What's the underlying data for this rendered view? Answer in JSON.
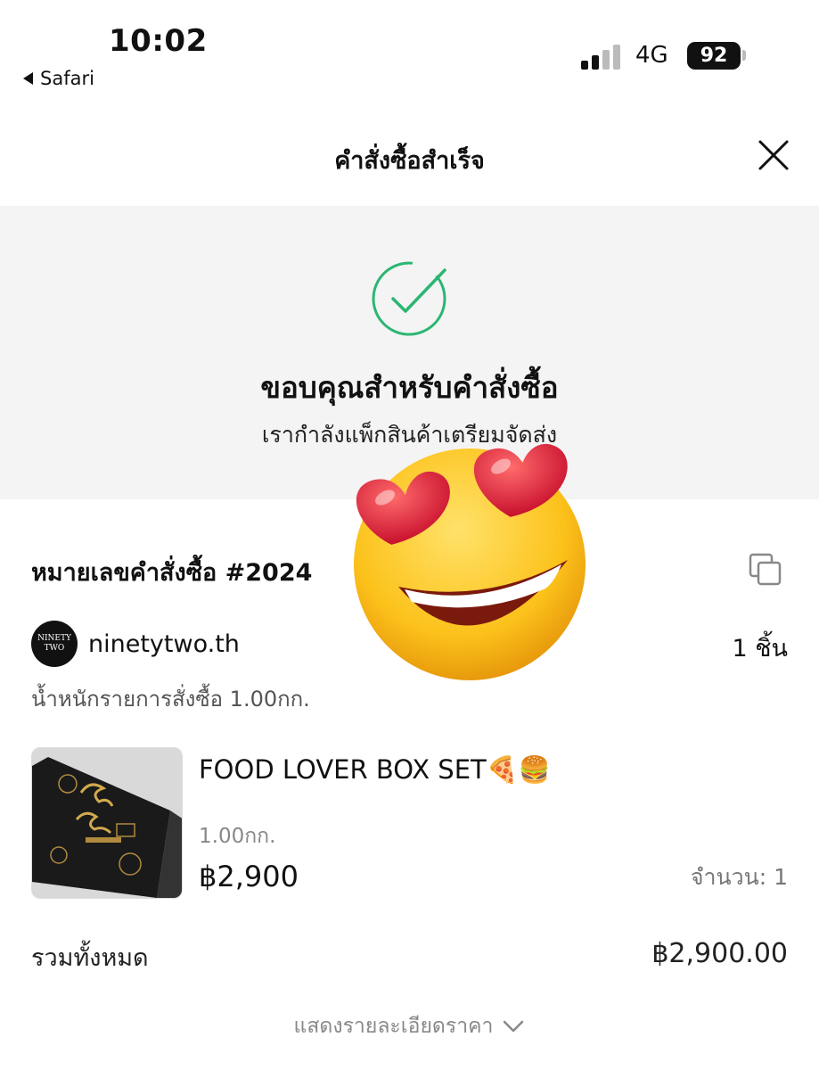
{
  "status_bar": {
    "time": "10:02",
    "back_app": "Safari",
    "network": "4G",
    "battery": "92"
  },
  "header": {
    "title": "คำสั่งซื้อสำเร็จ",
    "close_icon": "close-icon"
  },
  "banner": {
    "icon": "check-circle-icon",
    "icon_color": "#2bb673",
    "title": "ขอบคุณสำหรับคำสั่งซื้อ",
    "subtitle": "เรากำลังแพ็กสินค้าเตรียมจัดส่ง"
  },
  "order": {
    "number_label": "หมายเลขคำสั่งซื้อ #2024",
    "copy_icon": "copy-icon",
    "shop_name": "ninetytwo.th",
    "shop_avatar_text": "NINETY TWO",
    "piece_count": "1 ชิ้น",
    "weight_line": "น้ำหนักรายการสั่งซื้อ 1.00กก."
  },
  "product": {
    "name": "FOOD LOVER BOX SET🍕🍔",
    "weight": "1.00กก.",
    "price": "฿2,900",
    "quantity": "จำนวน: 1"
  },
  "summary": {
    "total_label": "รวมทั้งหมด",
    "total_value": "฿2,900.00",
    "details_link": "แสดงรายละเอียดราคา"
  },
  "overlay": {
    "emoji": "heart-eyes-emoji"
  }
}
